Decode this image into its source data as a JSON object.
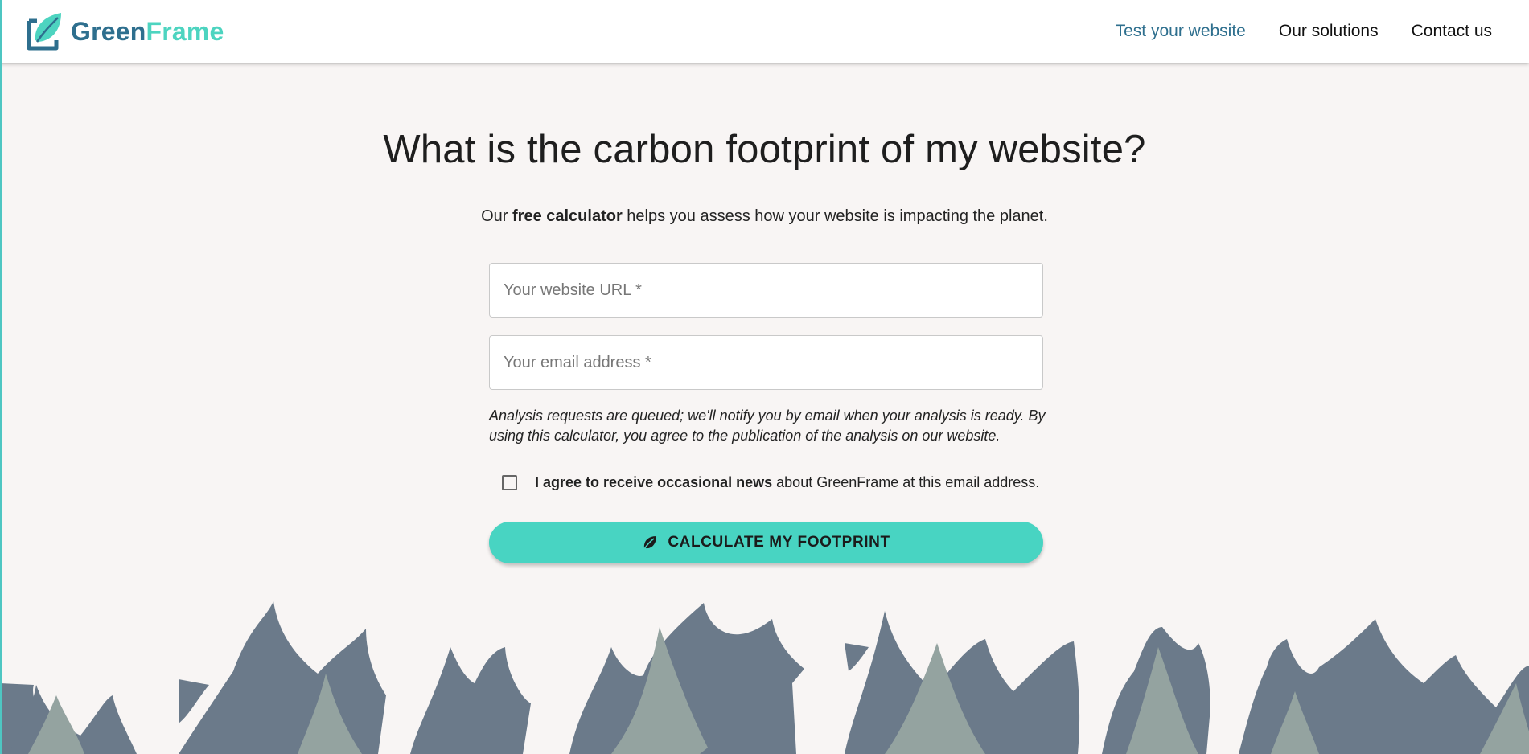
{
  "colors": {
    "accent": "#48d4c2",
    "brand_blue": "#2e6f8e",
    "background": "#f8f5f4",
    "tree_dark": "#6b7a8a",
    "tree_light": "#94a3a0"
  },
  "header": {
    "logo": {
      "green": "Green",
      "frame": "Frame",
      "icon": "leaf-frame-icon"
    },
    "nav": [
      {
        "label": "Test your website",
        "active": true
      },
      {
        "label": "Our solutions",
        "active": false
      },
      {
        "label": "Contact us",
        "active": false
      }
    ]
  },
  "hero": {
    "title": "What is the carbon footprint of my website?",
    "subtitle_prefix": "Our ",
    "subtitle_bold": "free calculator",
    "subtitle_suffix": " helps you assess how your website is impacting the planet."
  },
  "form": {
    "url_placeholder": "Your website URL *",
    "url_value": "",
    "email_placeholder": "Your email address *",
    "email_value": "",
    "notice": "Analysis requests are queued; we'll notify you by email when your analysis is ready. By using this calculator, you agree to the publication of the analysis on our website.",
    "consent_bold": "I agree to receive occasional news",
    "consent_rest": " about GreenFrame at this email address.",
    "consent_checked": false,
    "submit_label": "CALCULATE MY FOOTPRINT",
    "submit_icon": "leaf-icon"
  }
}
